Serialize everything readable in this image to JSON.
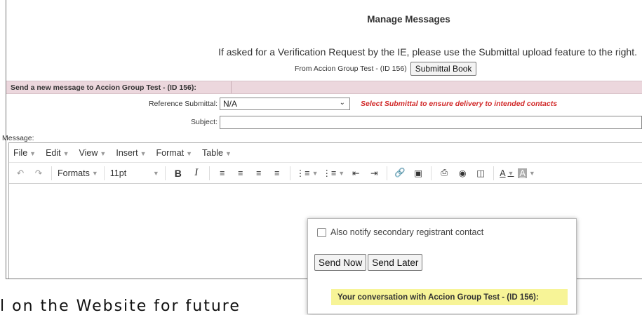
{
  "page_title": "Manage Messages",
  "verification_note": "If asked for a Verification Request by the IE, please use the Submittal upload feature to the right.",
  "from_line": "From Accion Group Test - (ID 156)",
  "submittal_book_button": "Submittal Book",
  "send_banner": "Send a new message to Accion Group Test - (ID 156):",
  "reference": {
    "label": "Reference Submittal:",
    "value": "N/A",
    "warning": "Select Submittal to ensure delivery to intended contacts"
  },
  "subject": {
    "label": "Subject:",
    "value": ""
  },
  "message_label": "Message:",
  "editor": {
    "menus": [
      "File",
      "Edit",
      "View",
      "Insert",
      "Format",
      "Table"
    ],
    "formats_label": "Formats",
    "font_size": "11pt",
    "bold": "B",
    "italic": "I",
    "font_color_label": "A",
    "bg_color_label": "A"
  },
  "popup": {
    "notify_label": "Also notify secondary registrant contact",
    "send_now": "Send Now",
    "send_later": "Send Later",
    "conversation_heading": "Your conversation with Accion Group Test - (ID 156):"
  },
  "background_text": "l on the Website for future",
  "colors": {
    "banner_bg": "#ecd7dd",
    "warning": "#d12a2a",
    "highlight": "#f7f497"
  }
}
